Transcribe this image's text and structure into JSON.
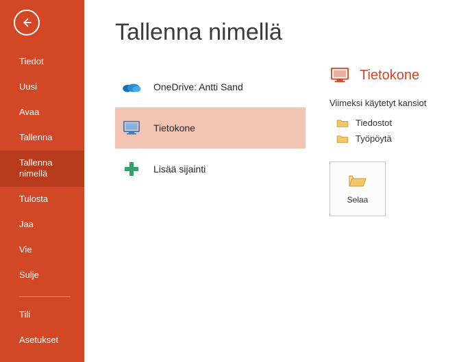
{
  "sidebar": {
    "items": [
      {
        "label": "Tiedot"
      },
      {
        "label": "Uusi"
      },
      {
        "label": "Avaa"
      },
      {
        "label": "Tallenna"
      },
      {
        "label": "Tallenna nimellä"
      },
      {
        "label": "Tulosta"
      },
      {
        "label": "Jaa"
      },
      {
        "label": "Vie"
      },
      {
        "label": "Sulje"
      }
    ],
    "bottom": [
      {
        "label": "Tili"
      },
      {
        "label": "Asetukset"
      }
    ]
  },
  "page": {
    "title": "Tallenna nimellä"
  },
  "locations": [
    {
      "label": "OneDrive: Antti Sand",
      "icon": "onedrive"
    },
    {
      "label": "Tietokone",
      "icon": "computer",
      "selected": true
    },
    {
      "label": "Lisää sijainti",
      "icon": "add"
    }
  ],
  "right": {
    "title": "Tietokone",
    "recentHeading": "Viimeksi käytetyt kansiot",
    "folders": [
      {
        "label": "Tiedostot"
      },
      {
        "label": "Työpöytä"
      }
    ],
    "browseLabel": "Selaa"
  },
  "colors": {
    "accent": "#d24726"
  }
}
